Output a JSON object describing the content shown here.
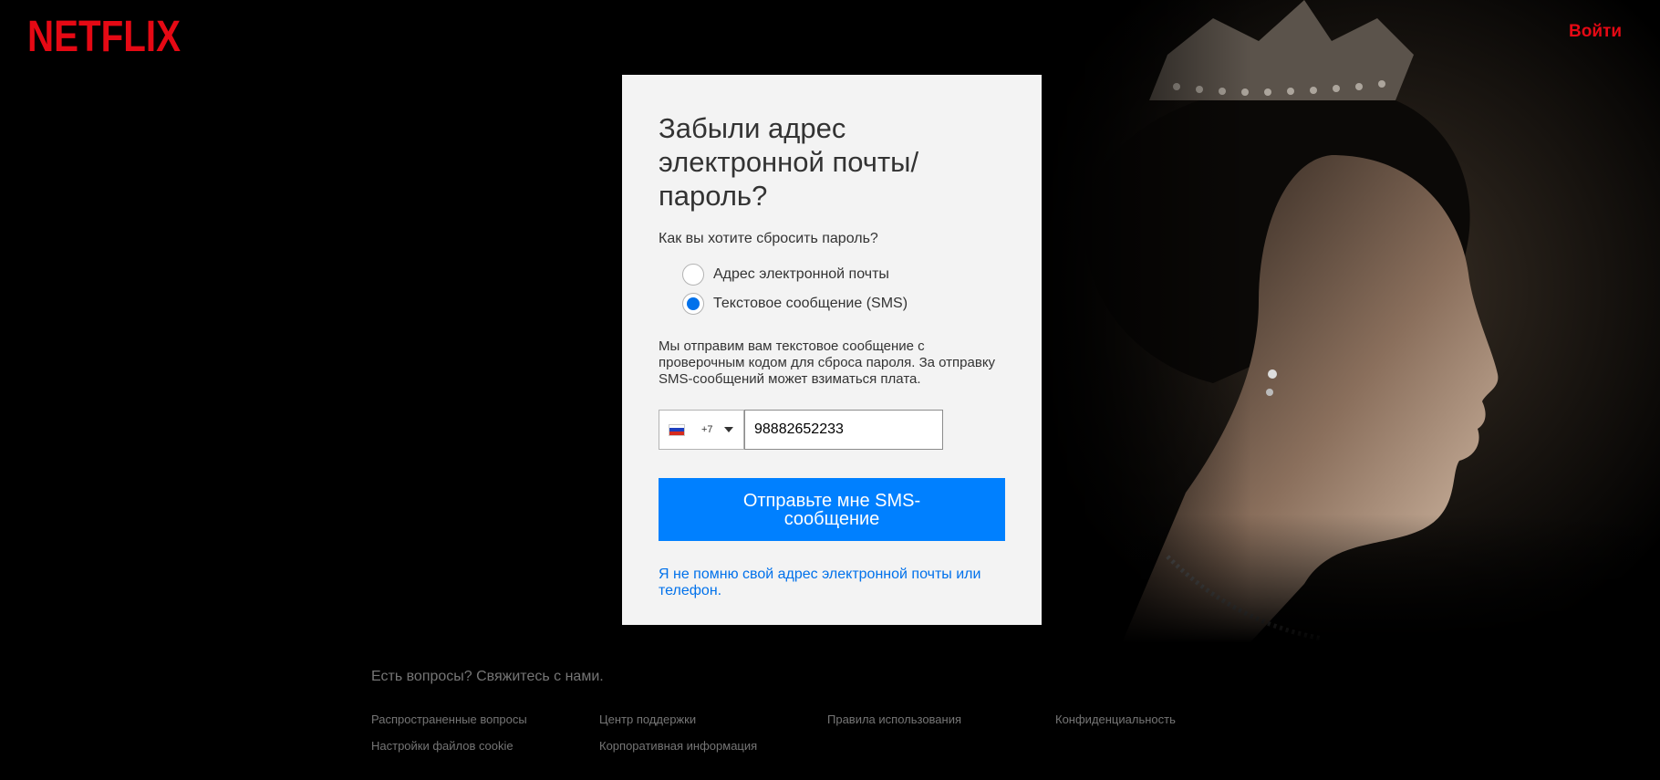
{
  "brand": {
    "logo_text": "NETFLIX",
    "logo_color": "#e50914"
  },
  "header": {
    "signin_label": "Войти"
  },
  "form": {
    "title": "Забыли адрес электронной почты/ пароль?",
    "question": "Как вы хотите сбросить пароль?",
    "options": [
      {
        "label": "Адрес электронной почты",
        "selected": false
      },
      {
        "label": "Текстовое сообщение (SMS)",
        "selected": true
      }
    ],
    "info": "Мы отправим вам текстовое сообщение с проверочным кодом для сброса пароля. За отправку SMS-сообщений может взиматься плата.",
    "country": {
      "flag": "russia-flag-icon",
      "dial_code": "+7"
    },
    "phone_value": "98882652233",
    "submit_label": "Отправьте мне SMS-сообщение",
    "forgot_link": "Я не помню свой адрес электронной почты или телефон.",
    "accent_color": "#0080ff"
  },
  "footer": {
    "contact_text": "Есть вопросы? Свяжитесь с нами.",
    "links": [
      "Распространенные вопросы",
      "Центр поддержки",
      "Правила использования",
      "Конфиденциальность",
      "Настройки файлов cookie",
      "Корпоративная информация"
    ]
  }
}
